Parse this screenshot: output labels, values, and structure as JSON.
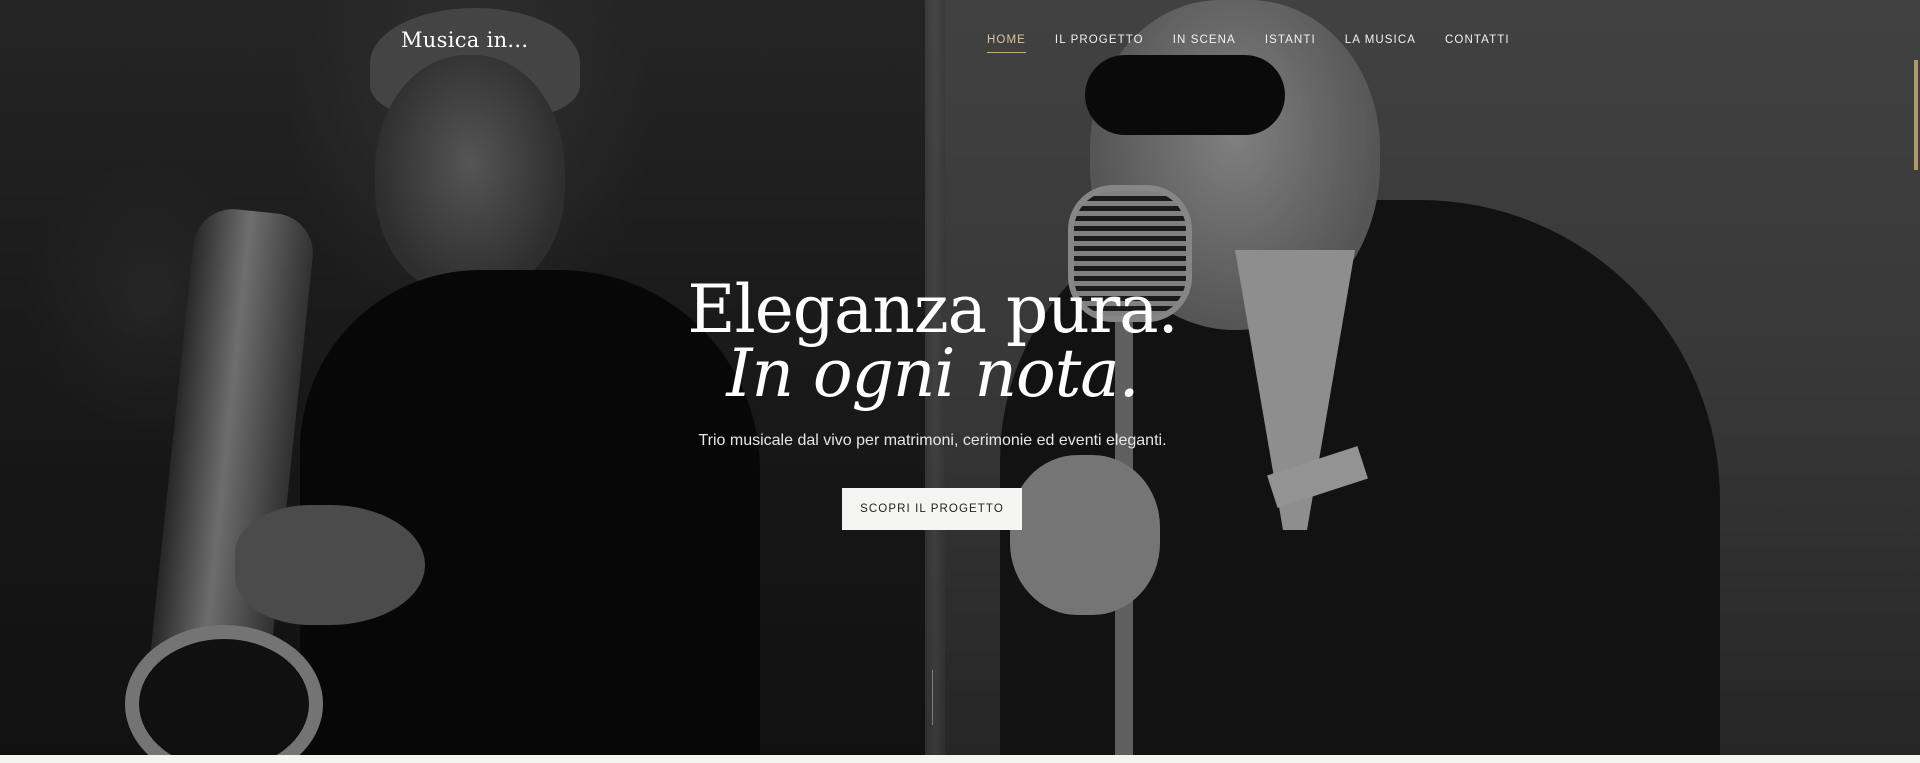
{
  "header": {
    "logo": "Musica in..."
  },
  "nav": {
    "items": [
      {
        "label": "HOME",
        "active": true
      },
      {
        "label": "IL PROGETTO",
        "active": false
      },
      {
        "label": "IN SCENA",
        "active": false
      },
      {
        "label": "ISTANTI",
        "active": false
      },
      {
        "label": "LA MUSICA",
        "active": false
      },
      {
        "label": "CONTATTI",
        "active": false
      }
    ]
  },
  "hero": {
    "headline_line1": "Eleganza pura.",
    "headline_line2": "In ogni nota.",
    "subtitle": "Trio musicale dal vivo per matrimoni, cerimonie ed eventi eleganti.",
    "cta_label": "SCOPRI IL PROGETTO"
  },
  "colors": {
    "accent": "#c9b07a",
    "text": "#ffffff",
    "button_bg": "#f5f5f3"
  }
}
